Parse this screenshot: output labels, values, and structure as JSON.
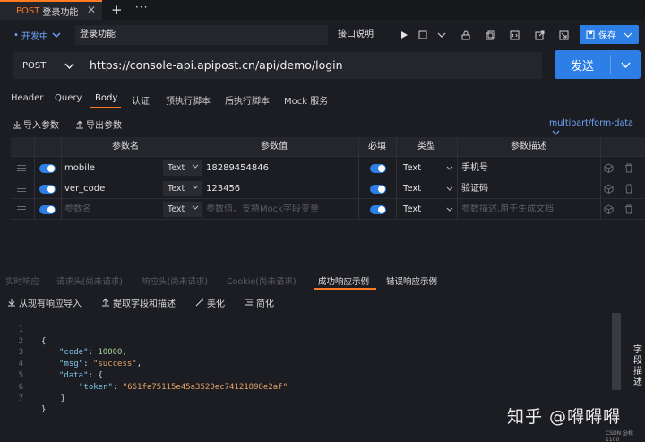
{
  "tab": {
    "method": "POST",
    "title": "登录功能",
    "close": "✕",
    "add": "+",
    "more": "···"
  },
  "env": {
    "label": "开发中"
  },
  "api_name": "登录功能",
  "doc_button": "接口说明",
  "save_button": "保存",
  "request": {
    "method": "POST",
    "url": "https://console-api.apipost.cn/api/demo/login",
    "send": "发送"
  },
  "request_tabs": [
    "Header",
    "Query",
    "Body",
    "认证",
    "预执行脚本",
    "后执行脚本",
    "Mock 服务"
  ],
  "body_actions": {
    "import": "导入参数",
    "export": "导出参数",
    "content_type": "multipart/form-data"
  },
  "params_table": {
    "headers": [
      "参数名",
      "参数值",
      "必填",
      "类型",
      "参数描述"
    ],
    "rows": [
      {
        "name": "mobile",
        "value_type": "Text",
        "value": "18289454846",
        "type": "Text",
        "desc": "手机号"
      },
      {
        "name": "ver_code",
        "value_type": "Text",
        "value": "123456",
        "type": "Text",
        "desc": "验证码"
      },
      {
        "name": "参数名",
        "value_type": "Text",
        "value": "参数值、支持Mock字段变量",
        "type": "Text",
        "desc": "参数描述,用于生成文档"
      }
    ]
  },
  "response_tabs": [
    "实时响应",
    "请求头(尚未请求)",
    "响应头(尚未请求)",
    "Cookie(尚未请求)",
    "成功响应示例",
    "错误响应示例"
  ],
  "response_tools": [
    "从现有响应导入",
    "提取字段和描述",
    "美化",
    "简化"
  ],
  "code_lines": [
    {
      "n": "1",
      "text": "{"
    },
    {
      "n": "2",
      "key": "\"code\"",
      "val": "10000",
      "indent": 1
    },
    {
      "n": "3",
      "key": "\"msg\"",
      "val": "\"success\"",
      "indent": 1
    },
    {
      "n": "4",
      "key": "\"data\"",
      "val": "{",
      "indent": 1
    },
    {
      "n": "5",
      "key": "\"token\"",
      "val": "\"661fe75115e45a3520ec74121898e2af\"",
      "indent": 2
    },
    {
      "n": "6",
      "text": "    }"
    },
    {
      "n": "7",
      "text": "}"
    }
  ],
  "side_panel": "字段描述",
  "watermark": "知乎 @嘚嘚嘚",
  "watermark_small": "CSDN @松1100"
}
